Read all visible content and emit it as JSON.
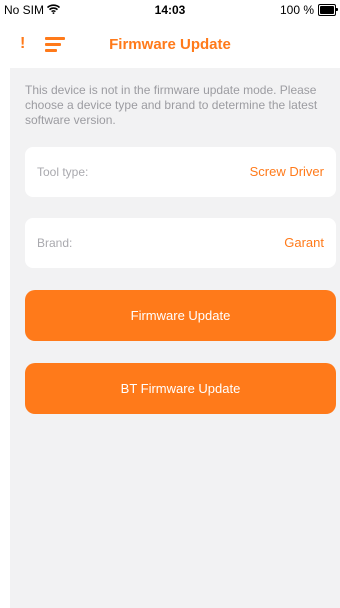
{
  "status_bar": {
    "carrier": "No SIM",
    "time": "14:03",
    "battery": "100 %"
  },
  "nav": {
    "alert": "!",
    "title": "Firmware Update"
  },
  "info_text": "This device is not in the firmware update mode. Please choose a device type and brand to determine the latest software version.",
  "tool_type": {
    "label": "Tool type:",
    "value": "Screw Driver"
  },
  "brand": {
    "label": "Brand:",
    "value": "Garant"
  },
  "buttons": {
    "firmware_update": "Firmware Update",
    "bt_firmware_update": "BT Firmware Update"
  },
  "colors": {
    "accent": "#ff7a1a",
    "background": "#f2f2f3",
    "secondary_text": "#9c9ca1"
  }
}
